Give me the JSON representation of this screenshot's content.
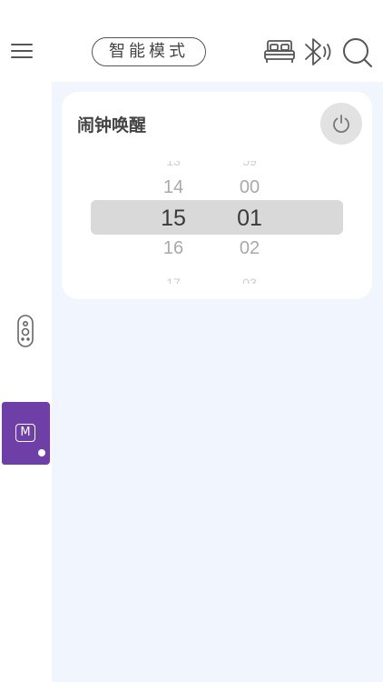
{
  "header": {
    "mode_label": "智能模式",
    "icons": [
      "menu-icon",
      "bed-icon",
      "bluetooth-icon",
      "search-icon"
    ]
  },
  "sidebar": {
    "items": [
      {
        "icon": "remote-icon",
        "active": false
      },
      {
        "icon": "mode-m-icon",
        "label": "M",
        "active": true
      }
    ]
  },
  "alarm": {
    "title": "闹钟唤醒",
    "hour_picker": {
      "prev": "14",
      "selected": "15",
      "next": "16"
    },
    "minute_picker": {
      "prev": "00",
      "selected": "01",
      "next": "02"
    }
  },
  "colors": {
    "accent": "#6e3fa6",
    "main_background": "#f1f6fe",
    "selection_band": "#d9d9d9",
    "power_button": "#e2e2e2"
  }
}
